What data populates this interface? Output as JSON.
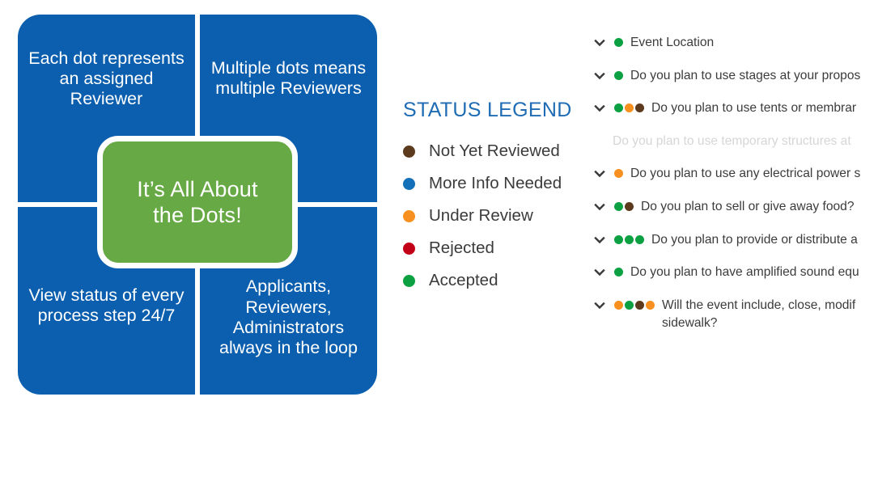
{
  "diagram": {
    "center_text": "It’s All About\nthe Dots!",
    "center_color": "#67a944",
    "quadrant_color": "#0b5fae",
    "quadrants": [
      {
        "id": "top-left",
        "text": "Each dot represents\nan assigned\nReviewer"
      },
      {
        "id": "top-right",
        "text": "Multiple dots means\nmultiple Reviewers"
      },
      {
        "id": "bottom-left",
        "text": "View status of every\nprocess step 24/7"
      },
      {
        "id": "bottom-right",
        "text": "Applicants,\nReviewers,\nAdministrators\nalways in the loop"
      }
    ]
  },
  "legend": {
    "title": "STATUS LEGEND",
    "title_color": "#1f6cb4",
    "items": [
      {
        "label": "Not Yet Reviewed",
        "color": "#5c3a1e"
      },
      {
        "label": "More Info Needed",
        "color": "#1271b8"
      },
      {
        "label": "Under Review",
        "color": "#f7901e"
      },
      {
        "label": "Rejected",
        "color": "#c20017"
      },
      {
        "label": "Accepted",
        "color": "#0ba041"
      }
    ]
  },
  "questions": {
    "chevron_icon": "chevron-down-icon",
    "rows": [
      {
        "text": "Event Location",
        "dots": [
          "#0ba041"
        ],
        "disabled": false
      },
      {
        "text": "Do you plan to use stages at your propos",
        "dots": [
          "#0ba041"
        ],
        "disabled": false
      },
      {
        "text": "Do you plan to use tents or membrar",
        "dots": [
          "#0ba041",
          "#f7901e",
          "#5c3a1e"
        ],
        "disabled": false
      },
      {
        "text": "Do you plan to use temporary structures at ",
        "dots": [],
        "disabled": true
      },
      {
        "text": "Do you plan to use any electrical power s",
        "dots": [
          "#f7901e"
        ],
        "disabled": false
      },
      {
        "text": "Do you plan to sell or give away food?",
        "dots": [
          "#0ba041",
          "#5c3a1e"
        ],
        "disabled": false
      },
      {
        "text": "Do you plan to provide or distribute a",
        "dots": [
          "#0ba041",
          "#0ba041",
          "#0ba041"
        ],
        "disabled": false
      },
      {
        "text": "Do you plan to have amplified sound equ",
        "dots": [
          "#0ba041"
        ],
        "disabled": false
      },
      {
        "text": "Will the event include, close, modif\nsidewalk?",
        "dots": [
          "#f7901e",
          "#0ba041",
          "#5c3a1e",
          "#f7901e"
        ],
        "disabled": false
      }
    ]
  }
}
